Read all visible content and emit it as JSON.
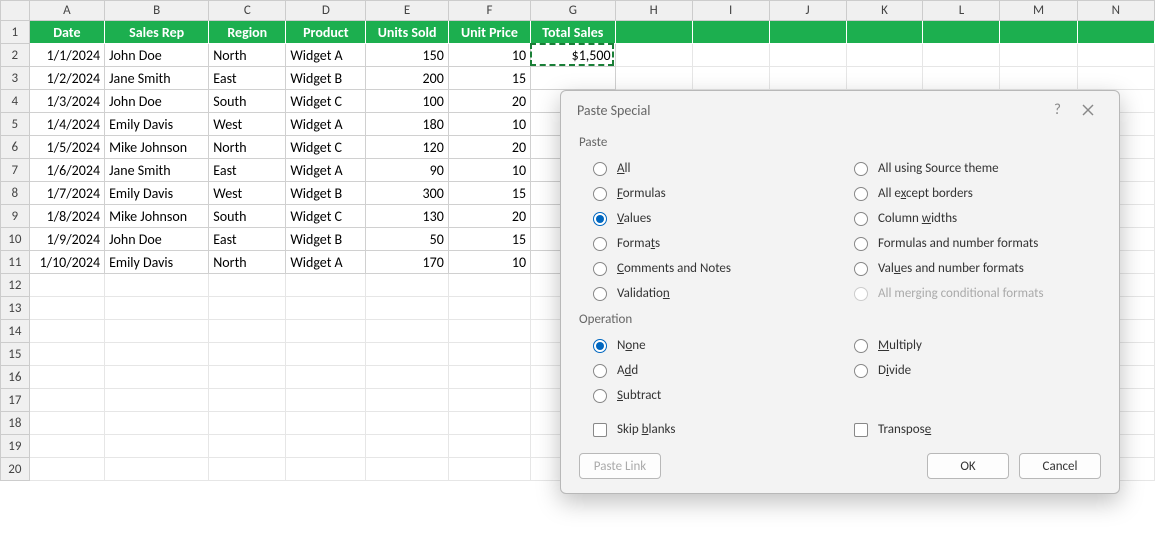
{
  "columns": [
    "A",
    "B",
    "C",
    "D",
    "E",
    "F",
    "G",
    "H",
    "I",
    "J",
    "K",
    "L",
    "M",
    "N"
  ],
  "rowCount": 20,
  "header": {
    "A": "Date",
    "B": "Sales Rep",
    "C": "Region",
    "D": "Product",
    "E": "Units Sold",
    "F": "Unit Price",
    "G": "Total Sales"
  },
  "rows": [
    {
      "A": "1/1/2024",
      "B": "John Doe",
      "C": "North",
      "D": "Widget A",
      "E": "150",
      "F": "10",
      "G": "$1,500"
    },
    {
      "A": "1/2/2024",
      "B": "Jane Smith",
      "C": "East",
      "D": "Widget B",
      "E": "200",
      "F": "15",
      "G": ""
    },
    {
      "A": "1/3/2024",
      "B": "John Doe",
      "C": "South",
      "D": "Widget C",
      "E": "100",
      "F": "20",
      "G": ""
    },
    {
      "A": "1/4/2024",
      "B": "Emily Davis",
      "C": "West",
      "D": "Widget A",
      "E": "180",
      "F": "10",
      "G": ""
    },
    {
      "A": "1/5/2024",
      "B": "Mike Johnson",
      "C": "North",
      "D": "Widget C",
      "E": "120",
      "F": "20",
      "G": ""
    },
    {
      "A": "1/6/2024",
      "B": "Jane Smith",
      "C": "East",
      "D": "Widget A",
      "E": "90",
      "F": "10",
      "G": ""
    },
    {
      "A": "1/7/2024",
      "B": "Emily Davis",
      "C": "West",
      "D": "Widget B",
      "E": "300",
      "F": "15",
      "G": ""
    },
    {
      "A": "1/8/2024",
      "B": "Mike Johnson",
      "C": "South",
      "D": "Widget C",
      "E": "130",
      "F": "20",
      "G": ""
    },
    {
      "A": "1/9/2024",
      "B": "John Doe",
      "C": "East",
      "D": "Widget B",
      "E": "50",
      "F": "15",
      "G": ""
    },
    {
      "A": "1/10/2024",
      "B": "Emily Davis",
      "C": "North",
      "D": "Widget A",
      "E": "170",
      "F": "10",
      "G": ""
    }
  ],
  "marqueeCell": "G2",
  "dialog": {
    "title": "Paste Special",
    "sections": {
      "paste": "Paste",
      "operation": "Operation"
    },
    "pasteLeft": [
      {
        "key": "all",
        "label": "All",
        "accel": "A",
        "checked": false
      },
      {
        "key": "formulas",
        "label": "Formulas",
        "accel": "F",
        "checked": false
      },
      {
        "key": "values",
        "label": "Values",
        "accel": "V",
        "checked": true
      },
      {
        "key": "formats",
        "label": "Formats",
        "accel": "T",
        "checked": false
      },
      {
        "key": "comments",
        "label": "Comments and Notes",
        "accel": "C",
        "checked": false
      },
      {
        "key": "validation",
        "label": "Validation",
        "accel": "N",
        "checked": false
      }
    ],
    "pasteRight": [
      {
        "key": "source-theme",
        "label": "All using Source theme",
        "accel": null,
        "checked": false
      },
      {
        "key": "except-borders",
        "label": "All except borders",
        "accel": "x",
        "checked": false
      },
      {
        "key": "col-widths",
        "label": "Column widths",
        "accel": "W",
        "checked": false
      },
      {
        "key": "formulas-number",
        "label": "Formulas and number formats",
        "accel": null,
        "checked": false
      },
      {
        "key": "values-number",
        "label": "Values and number formats",
        "accel": "u",
        "checked": false
      },
      {
        "key": "merging-cond",
        "label": "All merging conditional formats",
        "accel": null,
        "checked": false,
        "disabled": true
      }
    ],
    "operationLeft": [
      {
        "key": "none",
        "label": "None",
        "accel": "o",
        "checked": true
      },
      {
        "key": "add",
        "label": "Add",
        "accel": "d",
        "checked": false
      },
      {
        "key": "subtract",
        "label": "Subtract",
        "accel": "S",
        "checked": false
      }
    ],
    "operationRight": [
      {
        "key": "multiply",
        "label": "Multiply",
        "accel": "M",
        "checked": false
      },
      {
        "key": "divide",
        "label": "Divide",
        "accel": "i",
        "checked": false
      }
    ],
    "checkboxes": {
      "skipBlanks": {
        "label": "Skip blanks",
        "accel": "b",
        "checked": false
      },
      "transpose": {
        "label": "Transpose",
        "accel": "E",
        "checked": false
      }
    },
    "buttons": {
      "pasteLink": "Paste Link",
      "ok": "OK",
      "cancel": "Cancel"
    }
  }
}
